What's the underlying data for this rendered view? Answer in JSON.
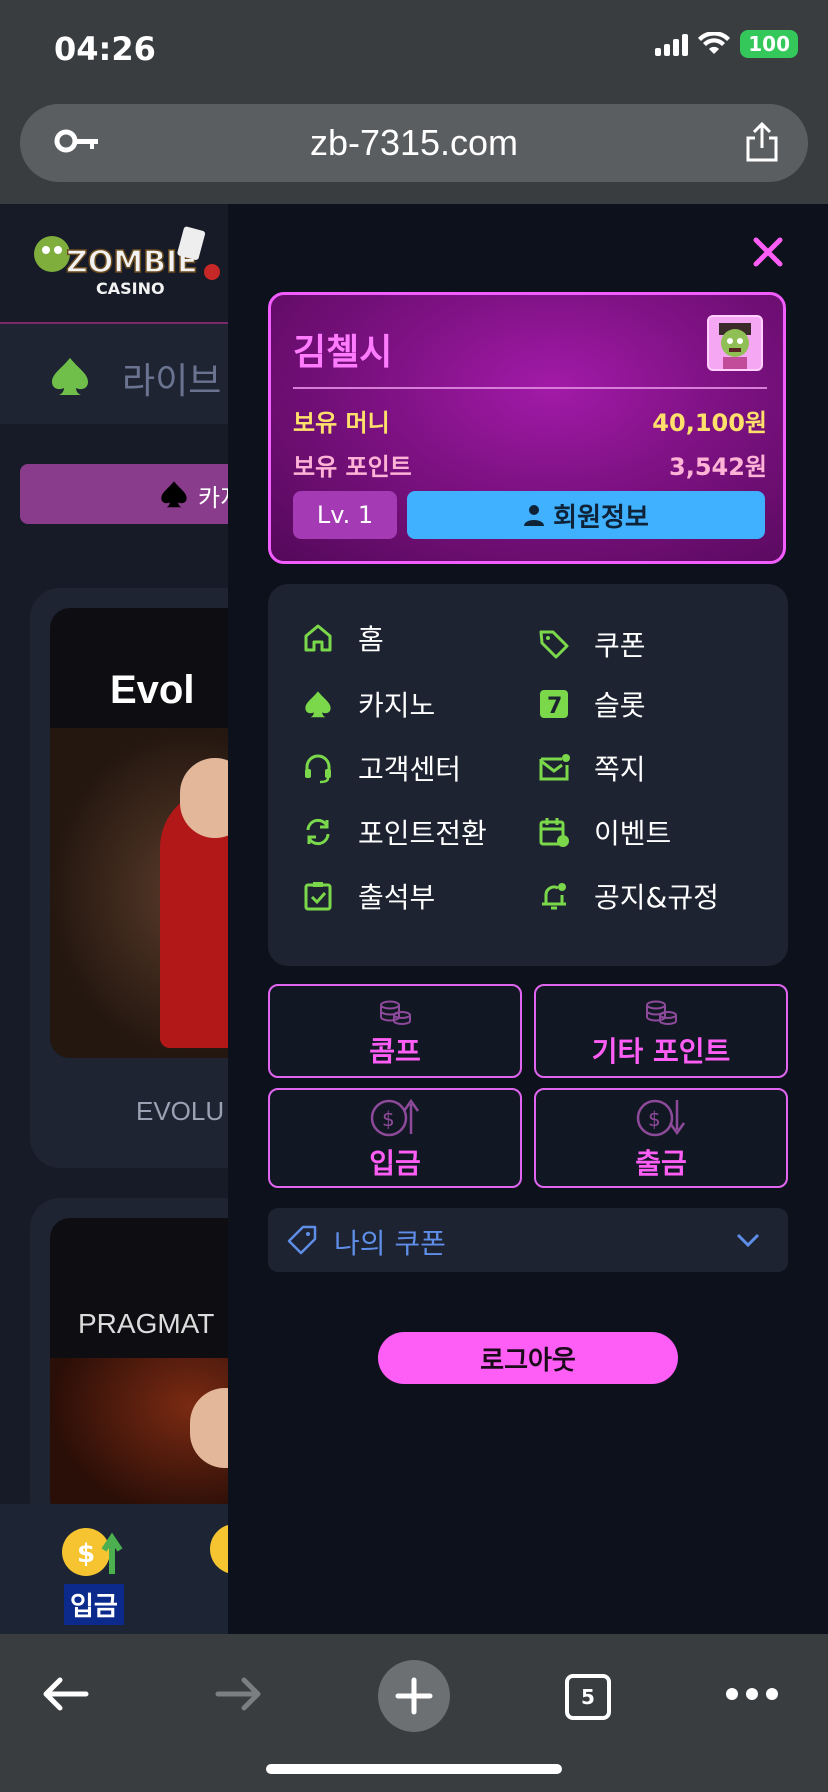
{
  "status_bar": {
    "time": "04:26",
    "battery": "100"
  },
  "browser": {
    "url": "zb-7315.com",
    "tab_count": "5"
  },
  "site": {
    "logo_text_top": "ZOMBIE",
    "logo_text_bottom": "CASINO",
    "nav_label": "라이브",
    "tab_label": "카지",
    "cards": [
      {
        "brand": "Evol",
        "caption": "EVOLU"
      },
      {
        "brand": "PRAGMAT",
        "caption": ""
      }
    ],
    "bottom_deposit_label": "입금"
  },
  "drawer": {
    "profile": {
      "name": "김첼시",
      "money_label": "보유 머니",
      "money_value": "40,100원",
      "points_label": "보유 포인트",
      "points_value": "3,542원",
      "level": "Lv. 1",
      "info_button": "회원정보"
    },
    "menu": [
      {
        "label": "홈",
        "icon": "home-icon"
      },
      {
        "label": "쿠폰",
        "icon": "tag-icon"
      },
      {
        "label": "카지노",
        "icon": "spade-icon"
      },
      {
        "label": "슬롯",
        "icon": "seven-icon"
      },
      {
        "label": "고객센터",
        "icon": "headset-icon"
      },
      {
        "label": "쪽지",
        "icon": "mail-icon"
      },
      {
        "label": "포인트전환",
        "icon": "refresh-icon"
      },
      {
        "label": "이벤트",
        "icon": "calendar-icon"
      },
      {
        "label": "출석부",
        "icon": "clipboard-check-icon"
      },
      {
        "label": "공지&규정",
        "icon": "bell-icon"
      }
    ],
    "actions": {
      "comp": "콤프",
      "other_points": "기타 포인트",
      "deposit": "입금",
      "withdraw": "출금"
    },
    "coupon_dropdown": "나의 쿠폰",
    "logout": "로그아웃"
  },
  "colors": {
    "accent_pink": "#ff5ef6",
    "menu_icon_green": "#7ad84a",
    "info_blue": "#3fb1ff"
  }
}
